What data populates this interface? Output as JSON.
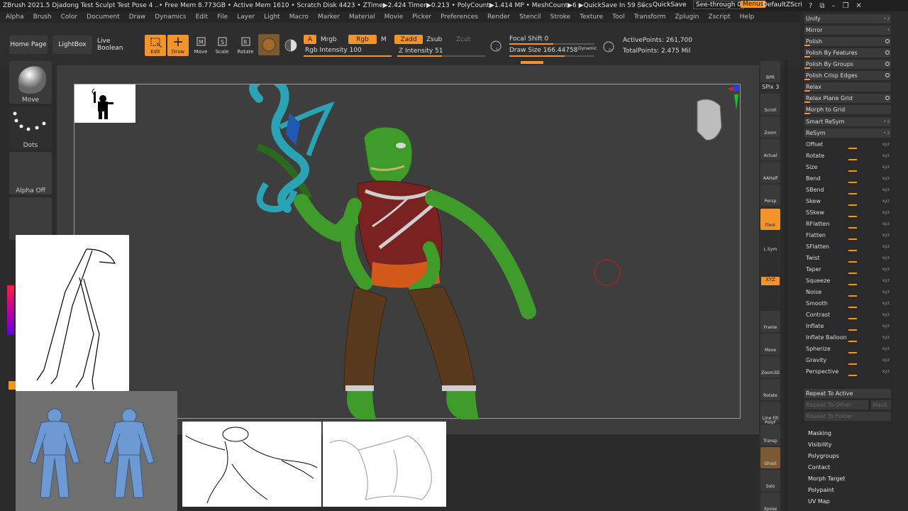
{
  "titlebar": {
    "text": "ZBrush 2021.5    Djadong Test Sculpt Test Pose 4   ..• Free Mem 8.773GB • Active Mem 1610 • Scratch Disk 4423 • ZTime▶2.424 Timer▶0.213 • PolyCount▶1.414 MP • MeshCount▶6  ▶QuickSave In 59 Secs",
    "ac": "AC",
    "quicksave": "QuickSave",
    "seethrough": "See-through  0",
    "menus": "Menus",
    "default_zscript": "DefaultZScript"
  },
  "menubar": [
    "Alpha",
    "Brush",
    "Color",
    "Document",
    "Draw",
    "Dynamics",
    "Edit",
    "File",
    "Layer",
    "Light",
    "Macro",
    "Marker",
    "Material",
    "Movie",
    "Picker",
    "Preferences",
    "Render",
    "Stencil",
    "Stroke",
    "Texture",
    "Tool",
    "Transform",
    "Zplugin",
    "Zscript",
    "Help"
  ],
  "shelf": {
    "home": "Home Page",
    "lightbox": "LightBox",
    "live_boolean": "Live Boolean",
    "edit": "Edit",
    "draw": "Draw",
    "move": "Move",
    "scale": "Scale",
    "rotate": "Rotate",
    "a": "A",
    "mrgb": "Mrgb",
    "rgb": "Rgb",
    "m": "M",
    "zadd": "Zadd",
    "zsub": "Zsub",
    "zcut": "Zcut",
    "rgb_intensity": "Rgb Intensity 100",
    "z_intensity": "Z Intensity 51",
    "focal_shift": "Focal Shift 0",
    "draw_size": "Draw Size 166.44758",
    "dynamic": "Dynamic",
    "active_points": "ActivePoints: 261,700",
    "total_points": "TotalPoints: 2.475 Mil",
    "rgb_intensity_val": 100,
    "z_intensity_val": 51
  },
  "left": {
    "move": "Move",
    "dots": "Dots",
    "alpha_off": "Alpha Off"
  },
  "right_strip": [
    "BPR",
    "SPix 3",
    "Scroll",
    "Zoom",
    "Actual",
    "AAHalf",
    "Persp",
    "Floor",
    "L.Sym",
    "XYZ",
    "Frame",
    "Move",
    "Zoom3D",
    "Rotate",
    "Line Fill PolyF",
    "Transp",
    "Ghost",
    "Solo",
    "Xpose"
  ],
  "tray": {
    "rows": [
      "Unify",
      "Mirror",
      "Polish",
      "Polish By Features",
      "Polish By Groups",
      "Polish Crisp Edges",
      "Relax",
      "Relax Plane Grid",
      "Morph to Grid",
      "Smart ReSym",
      "ReSym",
      "Offset",
      "Rotate",
      "Size",
      "Bend",
      "SBend",
      "Skew",
      "SSkew",
      "RFlatten",
      "Flatten",
      "SFlatten",
      "Twist",
      "Taper",
      "Squeeze",
      "Noise",
      "Smooth",
      "Contrast",
      "Inflate",
      "Inflate Balloon",
      "Spherize",
      "Gravity",
      "Perspective"
    ],
    "repeat_active": "Repeat To Active",
    "repeat_other": "Repeat To Other",
    "mask": "Mask",
    "repeat_folder": "Repeat To Folder"
  },
  "subpalettes": [
    "Masking",
    "Visibility",
    "Polygroups",
    "Contact",
    "Morph Target",
    "Polypaint",
    "UV Map"
  ],
  "colors": {
    "accent": "#f2942b",
    "bg": "#2b2b2b",
    "skin": "#3f9c2b",
    "vest": "#7a2222",
    "pants": "#5a3a1f",
    "staff": "#2aa3b5"
  }
}
